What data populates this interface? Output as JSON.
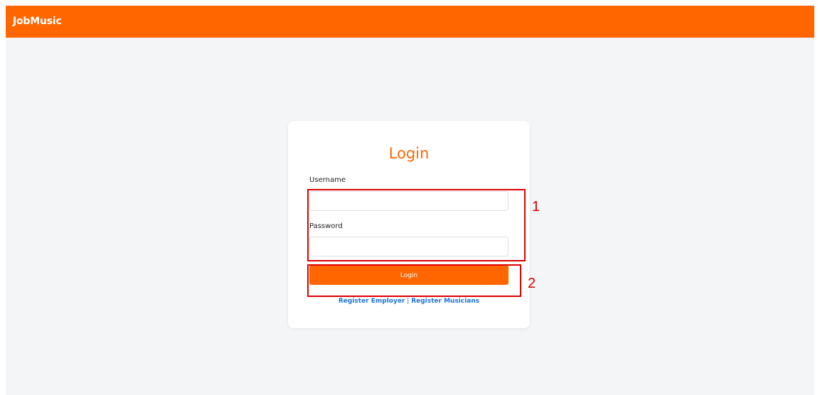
{
  "navbar": {
    "brand": "JobMusic"
  },
  "login_card": {
    "title": "Login",
    "username_label": "Username",
    "username_value": "",
    "password_label": "Password",
    "password_value": "",
    "login_button_label": "Login",
    "register_employer_label": "Register Employer",
    "separator": "|",
    "register_musicians_label": "Register Musicians"
  },
  "annotations": {
    "box_1_label": "1",
    "box_2_label": "2"
  },
  "colors": {
    "brand_orange": "#ff6600",
    "link_blue": "#1d72d6",
    "annotation_red": "#e00000",
    "page_background": "#f4f5f7"
  }
}
